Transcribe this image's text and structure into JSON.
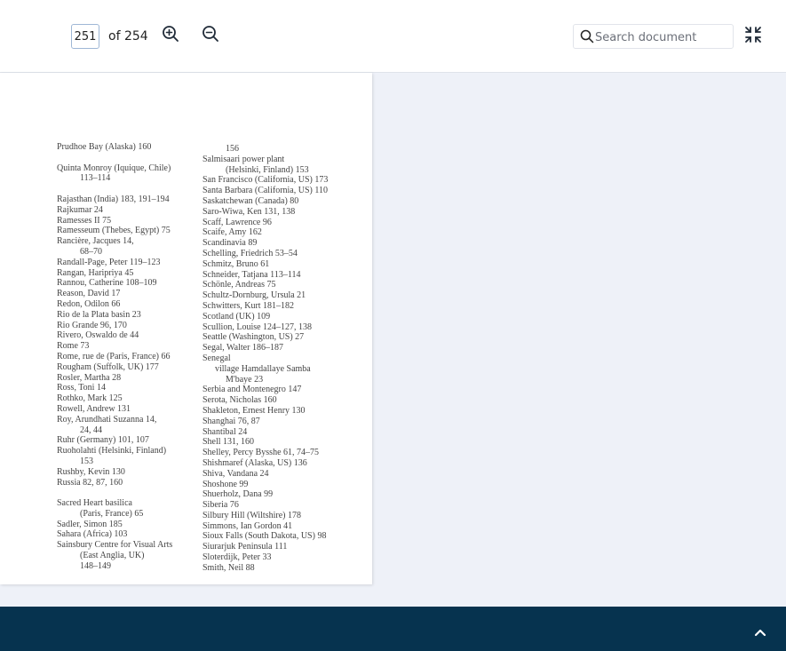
{
  "toolbar": {
    "page_current": "251",
    "page_total_label": "of 254",
    "zoom_in_icon": "zoom-in-icon",
    "zoom_out_icon": "zoom-out-icon",
    "search_placeholder": "Search document",
    "search_value": "",
    "collapse_icon": "collapse-icon"
  },
  "document": {
    "left_column": [
      {
        "text": "Prudhoe Bay (Alaska) 160",
        "indent": 0
      },
      {
        "text": "",
        "indent": 0
      },
      {
        "text": "Quinta Monroy (Iquique, Chile)",
        "indent": 0
      },
      {
        "text": "113–114",
        "indent": 1
      },
      {
        "text": "",
        "indent": 0
      },
      {
        "text": "Rajasthan (India) 183, 191–194",
        "indent": 0
      },
      {
        "text": "Rajkumar 24",
        "indent": 0
      },
      {
        "text": "Ramesses II 75",
        "indent": 0
      },
      {
        "text": "Ramesseum (Thebes, Egypt) 75",
        "indent": 0
      },
      {
        "text": "Rancière, Jacques 14,",
        "indent": 0
      },
      {
        "text": "68–70",
        "indent": 1
      },
      {
        "text": "Randall-Page, Peter 119–123",
        "indent": 0
      },
      {
        "text": "Rangan, Haripriya 45",
        "indent": 0
      },
      {
        "text": "Rannou, Catherine 108–109",
        "indent": 0
      },
      {
        "text": "Reason, David 17",
        "indent": 0
      },
      {
        "text": "Redon, Odilon 66",
        "indent": 0
      },
      {
        "text": "Rio de la Plata basin 23",
        "indent": 0
      },
      {
        "text": "Rio Grande 96, 170",
        "indent": 0
      },
      {
        "text": "Rivero, Oswaldo de 44",
        "indent": 0
      },
      {
        "text": "Rome 73",
        "indent": 0
      },
      {
        "text": "Rome, rue de (Paris, France) 66",
        "indent": 0
      },
      {
        "text": "Rougham (Suffolk, UK) 177",
        "indent": 0
      },
      {
        "text": "Rosler, Martha 28",
        "indent": 0
      },
      {
        "text": "Ross, Toni 14",
        "indent": 0
      },
      {
        "text": "Rothko, Mark 125",
        "indent": 0
      },
      {
        "text": "Rowell, Andrew 131",
        "indent": 0
      },
      {
        "text": "Roy, Arundhati Suzanna 14,",
        "indent": 0
      },
      {
        "text": "24, 44",
        "indent": 1
      },
      {
        "text": "Ruhr (Germany) 101, 107",
        "indent": 0
      },
      {
        "text": "Ruoholahti (Helsinki, Finland)",
        "indent": 0
      },
      {
        "text": "153",
        "indent": 1
      },
      {
        "text": "Rushby, Kevin 130",
        "indent": 0
      },
      {
        "text": "Russia 82, 87, 160",
        "indent": 0
      },
      {
        "text": "",
        "indent": 0
      },
      {
        "text": "Sacred Heart basilica",
        "indent": 0
      },
      {
        "text": "(Paris, France) 65",
        "indent": 1
      },
      {
        "text": "Sadler, Simon 185",
        "indent": 0
      },
      {
        "text": "Sahara (Africa) 103",
        "indent": 0
      },
      {
        "text": "Sainsbury Centre for Visual Arts",
        "indent": 0
      },
      {
        "text": "(East Anglia, UK)",
        "indent": 1
      },
      {
        "text": "148–149",
        "indent": 1
      }
    ],
    "right_column": [
      {
        "text": "156",
        "indent": 1
      },
      {
        "text": "Salmisaari power plant",
        "indent": 0
      },
      {
        "text": "(Helsinki, Finland) 153",
        "indent": 1
      },
      {
        "text": "San Francisco (California, US) 173",
        "indent": 0
      },
      {
        "text": "Santa Barbara (California, US) 110",
        "indent": 0
      },
      {
        "text": "Saskatchewan (Canada) 80",
        "indent": 0
      },
      {
        "text": "Saro-Wiwa, Ken 131, 138",
        "indent": 0
      },
      {
        "text": "Scaff, Lawrence 96",
        "indent": 0
      },
      {
        "text": "Scaife, Amy 162",
        "indent": 0
      },
      {
        "text": "Scandinavia 89",
        "indent": 0
      },
      {
        "text": "Schelling, Friedrich 53–54",
        "indent": 0
      },
      {
        "text": "Schmitz, Bruno 61",
        "indent": 0
      },
      {
        "text": "Schneider, Tatjana 113–114",
        "indent": 0
      },
      {
        "text": "Schönle, Andreas 75",
        "indent": 0
      },
      {
        "text": "Schultz-Dornburg, Ursula 21",
        "indent": 0
      },
      {
        "text": "Schwitters, Kurt 181–182",
        "indent": 0
      },
      {
        "text": "Scotland (UK) 109",
        "indent": 0
      },
      {
        "text": "Scullion, Louise 124–127, 138",
        "indent": 0
      },
      {
        "text": "Seattle (Washington, US) 27",
        "indent": 0
      },
      {
        "text": "Segal, Walter 186–187",
        "indent": 0
      },
      {
        "text": "Senegal",
        "indent": 0
      },
      {
        "text": "village Hamdallaye Samba",
        "indent": 2
      },
      {
        "text": "M'baye 23",
        "indent": 3
      },
      {
        "text": "Serbia and Montenegro 147",
        "indent": 0
      },
      {
        "text": "Serota, Nicholas 160",
        "indent": 0
      },
      {
        "text": "Shakleton, Ernest Henry 130",
        "indent": 0
      },
      {
        "text": "Shanghai 76, 87",
        "indent": 0
      },
      {
        "text": "Shantibal 24",
        "indent": 0
      },
      {
        "text": "Shell 131, 160",
        "indent": 0
      },
      {
        "text": "Shelley, Percy Bysshe 61, 74–75",
        "indent": 0
      },
      {
        "text": "Shishmaref (Alaska, US) 136",
        "indent": 0
      },
      {
        "text": "Shiva, Vandana 24",
        "indent": 0
      },
      {
        "text": "Shoshone 99",
        "indent": 0
      },
      {
        "text": "Shuerholz, Dana 99",
        "indent": 0
      },
      {
        "text": "Siberia 76",
        "indent": 0
      },
      {
        "text": "Silbury Hill (Wiltshire) 178",
        "indent": 0
      },
      {
        "text": "Simmons, Ian Gordon 41",
        "indent": 0
      },
      {
        "text": "Sioux Falls (South Dakota, US) 98",
        "indent": 0
      },
      {
        "text": "Siurarjuk Peninsula 111",
        "indent": 0
      },
      {
        "text": "Sloterdijk, Peter 33",
        "indent": 0
      },
      {
        "text": "Smith, Neil 88",
        "indent": 0
      }
    ]
  },
  "footer": {
    "back_to_top_icon": "chevron-up-icon",
    "background_color": "#06334f"
  }
}
